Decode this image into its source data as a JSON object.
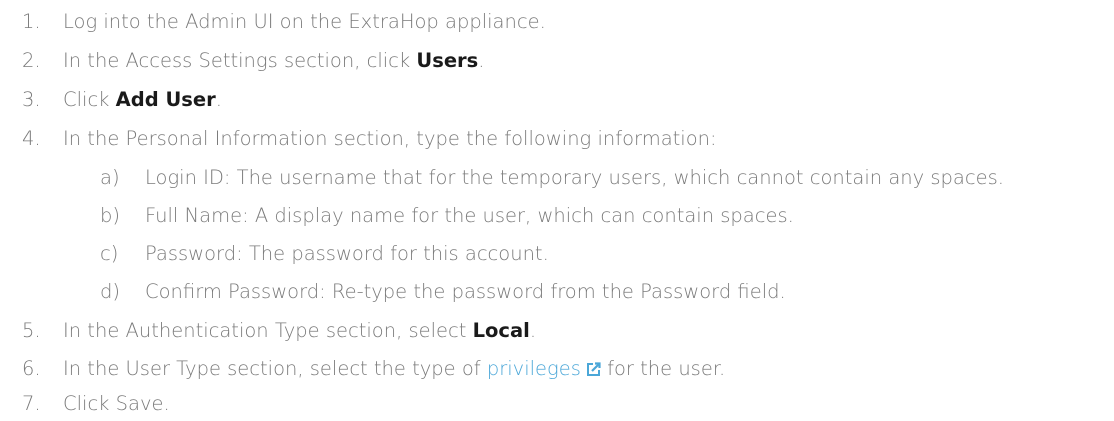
{
  "steps": [
    {
      "num": "1.",
      "pre": "Log into the Admin UI on the ExtraHop appliance."
    },
    {
      "num": "2.",
      "pre": "In the Access Settings section, click ",
      "bold": "Users",
      "post": "."
    },
    {
      "num": "3.",
      "pre": "Click ",
      "bold": "Add User",
      "post": "."
    },
    {
      "num": "4.",
      "pre": "In the Personal Information section, type the following information:"
    },
    {
      "num": "a)",
      "pre": "Login ID: The username that for the temporary users, which cannot contain any spaces."
    },
    {
      "num": "b)",
      "pre": "Full Name: A display name for the user, which can contain spaces."
    },
    {
      "num": "c)",
      "pre": "Password: The password for this account."
    },
    {
      "num": "d)",
      "pre": "Confirm Password: Re-type the password from the Password field."
    },
    {
      "num": "5.",
      "pre": "In the Authentication Type section, select ",
      "bold": "Local",
      "post": "."
    },
    {
      "num": "6.",
      "pre": "In the User Type section, select the type of ",
      "link": "privileges",
      "post": " for the user."
    },
    {
      "num": "7.",
      "pre": "Click Save."
    }
  ],
  "colors": {
    "text": "#7a7a7a",
    "bold": "#1a1a1a",
    "link": "#4ba7d8"
  },
  "icons": {
    "external_link": "external-link-icon"
  }
}
